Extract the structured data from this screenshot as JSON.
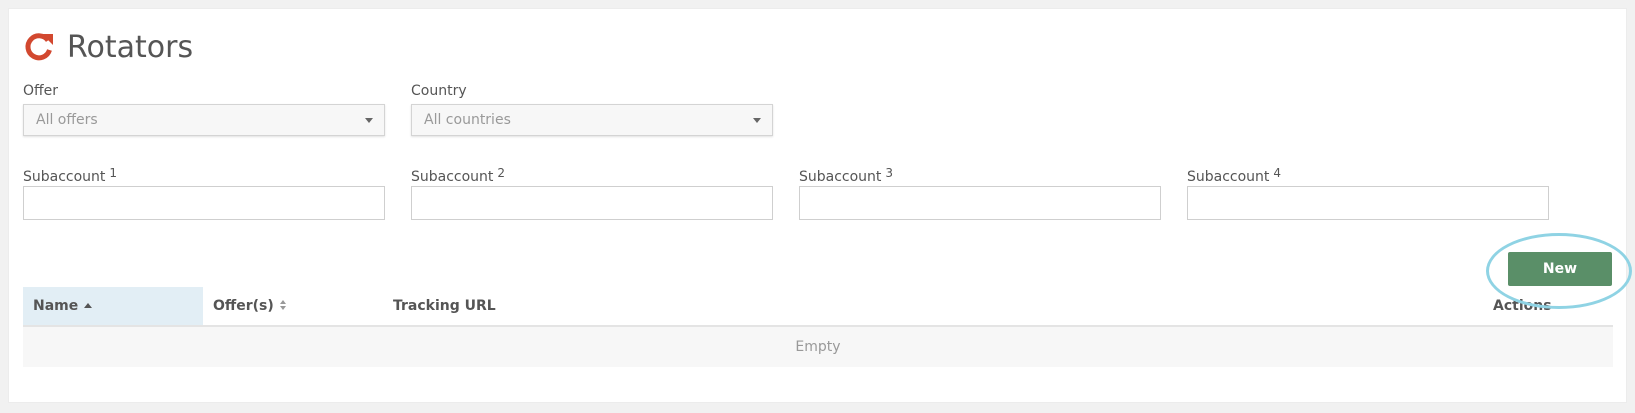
{
  "header": {
    "title": "Rotators",
    "icon": "refresh-icon",
    "accent_color": "#d2482f"
  },
  "filters": {
    "offer": {
      "label": "Offer",
      "value": "All offers"
    },
    "country": {
      "label": "Country",
      "value": "All countries"
    }
  },
  "subaccounts": [
    {
      "label": "Subaccount",
      "index": "1",
      "value": ""
    },
    {
      "label": "Subaccount",
      "index": "2",
      "value": ""
    },
    {
      "label": "Subaccount",
      "index": "3",
      "value": ""
    },
    {
      "label": "Subaccount",
      "index": "4",
      "value": ""
    }
  ],
  "toolbar": {
    "new_label": "New",
    "button_color": "#5a8f68"
  },
  "table": {
    "columns": [
      "Name",
      "Offer(s)",
      "Tracking URL",
      "Actions"
    ],
    "empty_text": "Empty"
  }
}
